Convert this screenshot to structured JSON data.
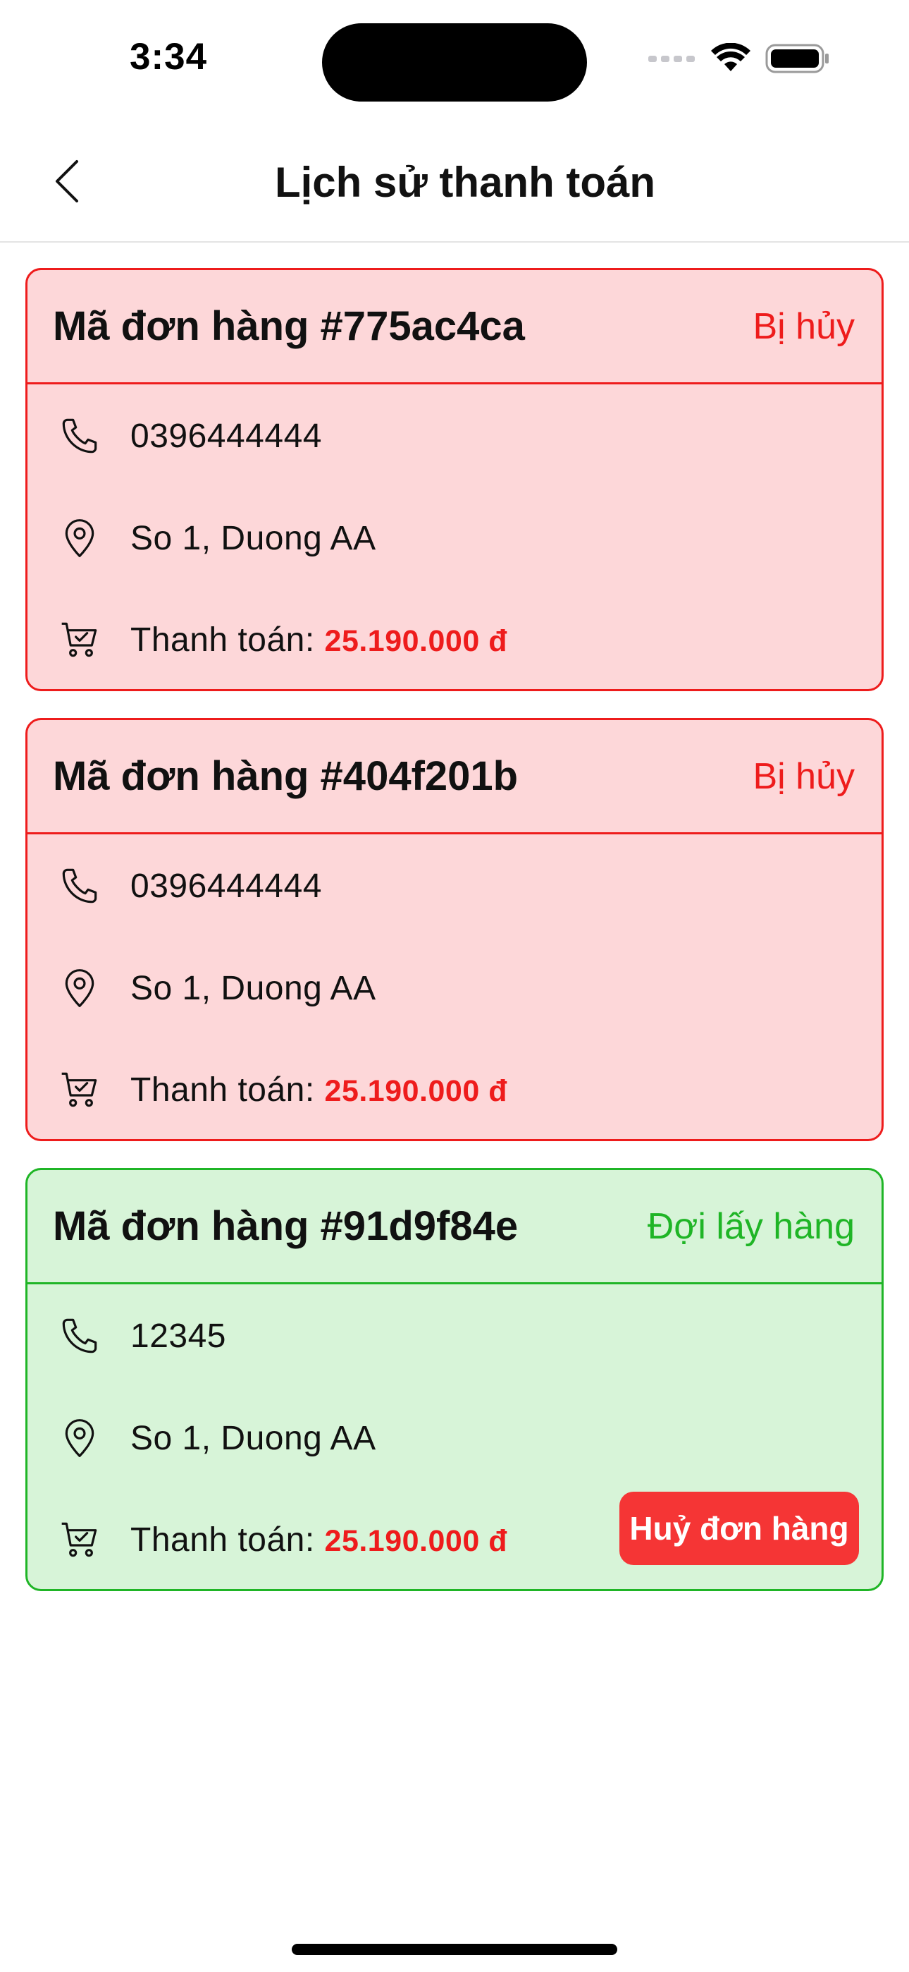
{
  "status_bar": {
    "time": "3:34"
  },
  "nav": {
    "title": "Lịch sử thanh toán",
    "back_icon": "chevron-left-icon"
  },
  "orders": [
    {
      "id_label": "Mã đơn hàng #775ac4ca",
      "status": "Bị hủy",
      "state": "cancelled",
      "phone": "0396444444",
      "address": "So 1, Duong AA",
      "payment_label": "Thanh toán: ",
      "amount": "25.190.000 đ"
    },
    {
      "id_label": "Mã đơn hàng #404f201b",
      "status": "Bị hủy",
      "state": "cancelled",
      "phone": "0396444444",
      "address": "So 1, Duong AA",
      "payment_label": "Thanh toán: ",
      "amount": "25.190.000 đ"
    },
    {
      "id_label": "Mã đơn hàng #91d9f84e",
      "status": "Đợi lấy hàng",
      "state": "pending",
      "phone": "12345",
      "address": "So 1, Duong AA",
      "payment_label": "Thanh toán: ",
      "amount": "25.190.000 đ",
      "cancel_button": "Huỷ đơn hàng"
    }
  ],
  "icons": {
    "phone": "phone-icon",
    "address": "location-pin-icon",
    "payment": "cart-check-icon"
  },
  "colors": {
    "cancelled_border": "#ee1c1c",
    "cancelled_bg": "#fdd7d9",
    "pending_border": "#1fb526",
    "pending_bg": "#d7f4d8",
    "cancel_button_bg": "#f53535"
  }
}
